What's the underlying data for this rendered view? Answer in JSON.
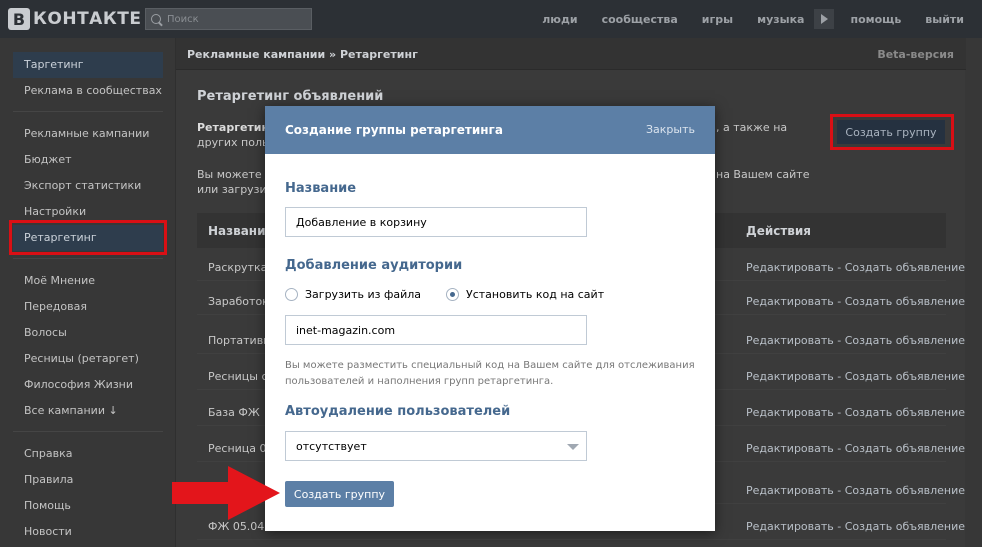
{
  "topbar": {
    "logo_letter": "В",
    "logo_text": "КОНТАКТЕ",
    "search_placeholder": "Поиск",
    "nav": [
      "люди",
      "сообщества",
      "игры",
      "музыка",
      "помощь",
      "выйти"
    ]
  },
  "sidebar": {
    "group1": [
      "Таргетинг",
      "Реклама в сообществах"
    ],
    "group2": [
      "Рекламные кампании",
      "Бюджет",
      "Экспорт статистики",
      "Настройки",
      "Ретаргетинг"
    ],
    "group3": [
      "Моё Мнение",
      "Передовая",
      "Волосы",
      "Ресницы (ретаргет)",
      "Философия Жизни",
      "Все кампании ↓"
    ],
    "group4": [
      "Справка",
      "Правила",
      "Помощь",
      "Новости"
    ]
  },
  "content": {
    "breadcrumb": "Рекламные кампании » Ретаргетинг",
    "beta": "Beta-версия",
    "section_title": "Ретаргетинг объявлений",
    "desc1_bold": "Ретаргетин",
    "desc1_line2": "других польз",
    "desc1_tail": ", а также на",
    "desc2_line1": "Вы можете со",
    "desc2_line2": "или загрузив",
    "desc2_tail": "на Вашем сайте",
    "create_button": "Создать группу",
    "table": {
      "col_name": "Название",
      "col_actions": "Действия",
      "rows": [
        "Раскрутка г",
        "Заработок н",
        "Портативно",
        "Ресницы с п",
        "База ФЖ",
        "Ресница 04.",
        "",
        "ФЖ 05.04.1"
      ],
      "action_text": "Редактировать - Создать объявление"
    }
  },
  "modal": {
    "title": "Создание группы ретаргетинга",
    "close": "Закрыть",
    "name_label": "Название",
    "name_value": "Добавление в корзину",
    "audience_label": "Добавление аудитории",
    "radio_file": "Загрузить из файла",
    "radio_code": "Установить код на сайт",
    "site_value": "inet-magazin.com",
    "hint": "Вы можете разместить специальный код на Вашем сайте для отслеживания пользователей и наполнения групп ретаргетинга.",
    "autodelete_label": "Автоудаление пользователей",
    "autodelete_value": "отсутствует",
    "submit": "Создать группу"
  },
  "colors": {
    "modal_header": "#5c7fa6",
    "highlight_red": "#d90f15",
    "label_blue": "#45688e"
  }
}
